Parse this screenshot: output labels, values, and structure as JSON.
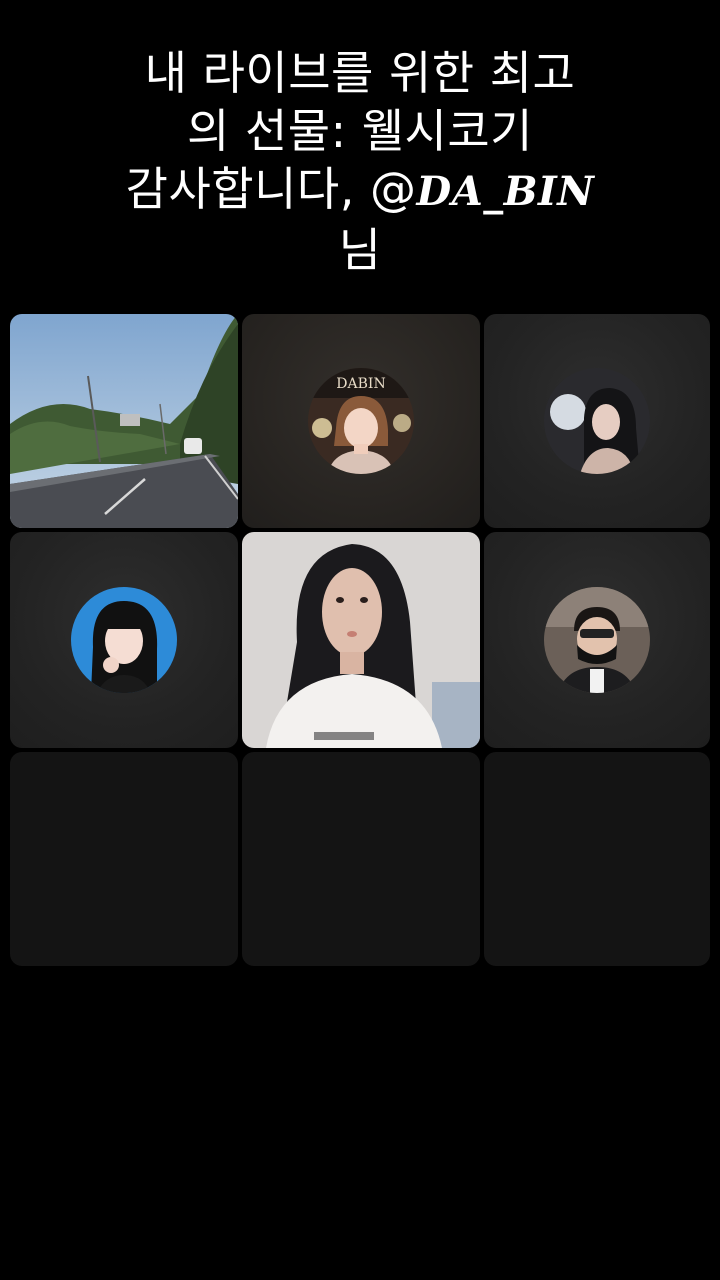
{
  "banner": {
    "line1": "내 라이브를 위한 최고",
    "line2": "의 선물: 웰시코기",
    "line3_prefix": "감사합니다, @",
    "line3_mention": "DA_BIN",
    "line4": "님"
  },
  "participants": [
    {
      "type": "video",
      "scene": "road-view"
    },
    {
      "type": "avatar",
      "avatar_caption": "DABIN"
    },
    {
      "type": "avatar"
    },
    {
      "type": "avatar"
    },
    {
      "type": "video",
      "scene": "host-camera"
    },
    {
      "type": "avatar"
    },
    {
      "type": "empty"
    },
    {
      "type": "empty"
    },
    {
      "type": "empty"
    }
  ]
}
